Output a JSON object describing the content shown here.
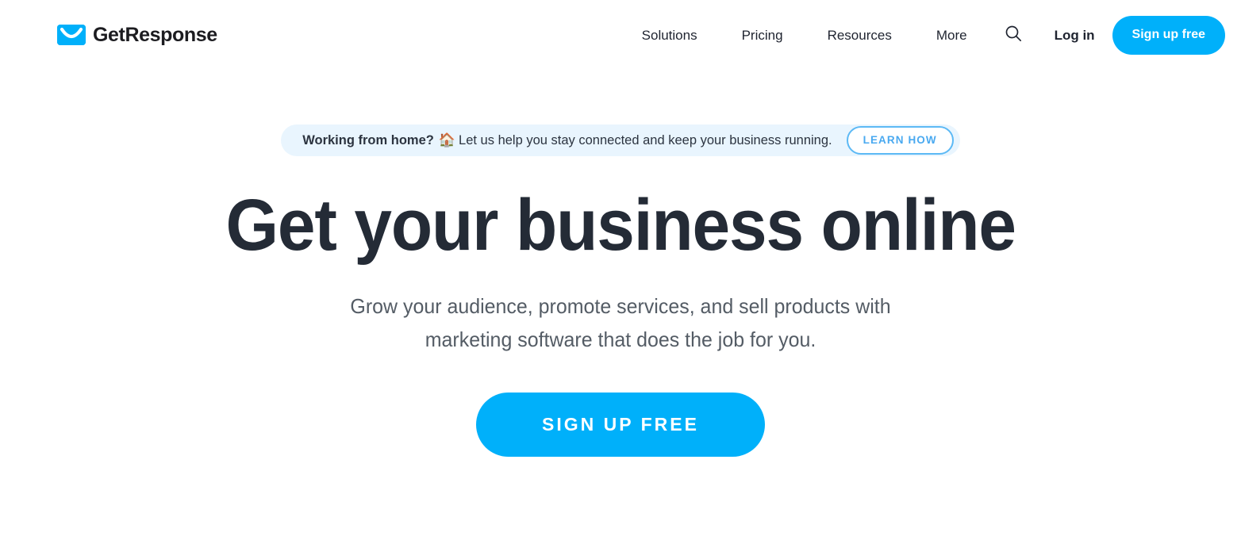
{
  "colors": {
    "accent": "#00b0fa",
    "banner_bg": "#e9f5fe",
    "learn_border": "#5cb9f5",
    "learn_text": "#49a9f0",
    "headline": "#242b36",
    "subhead": "#545c65",
    "nav_text": "#1f2430",
    "page_bg": "#ffffff"
  },
  "header": {
    "brand": {
      "name": "GetResponse",
      "logo_icon": "envelope-smile-icon"
    },
    "nav_items": [
      {
        "label": "Solutions"
      },
      {
        "label": "Pricing"
      },
      {
        "label": "Resources"
      },
      {
        "label": "More"
      }
    ],
    "search_icon": "search-icon",
    "login_label": "Log in",
    "signup_label": "Sign up free"
  },
  "hero": {
    "promo": {
      "bold_text": "Working from home?",
      "emoji": "🏠",
      "text": "Let us help you stay connected and keep your business running.",
      "button_label": "LEARN HOW"
    },
    "headline": "Get your business online",
    "subhead": "Grow your audience, promote services, and sell products with marketing software that does the job for you.",
    "cta_label": "SIGN UP FREE"
  }
}
